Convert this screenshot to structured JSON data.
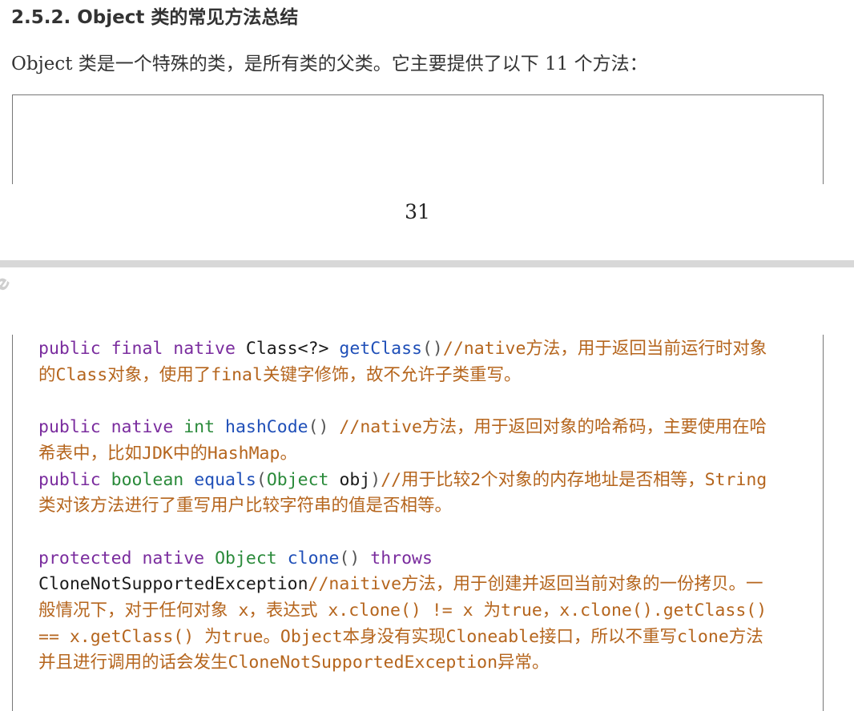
{
  "section": {
    "heading": "2.5.2. Object 类的常见方法总结",
    "intro": "Object 类是一个特殊的类，是所有类的父类。它主要提供了以下 11 个方法："
  },
  "page": {
    "number": "31",
    "watermark": "e"
  },
  "code": {
    "getClass": {
      "kw": "public final native",
      "type": "Class<?>",
      "name": "getClass",
      "paren": "()",
      "comment_a": "//native方法，用于返回当前运行时对象",
      "comment_b": "的Class对象，使用了final关键字修饰，故不允许子类重写。"
    },
    "hashCode": {
      "kw": "public native",
      "type": "int",
      "name": "hashCode",
      "paren": "()",
      "comment_a": " //native方法，用于返回对象的哈希码，主要使用在哈",
      "comment_b": "希表中，比如JDK中的HashMap。"
    },
    "equals": {
      "kw": "public",
      "type": "boolean",
      "name": "equals",
      "paren_open": "(",
      "param_type": "Object",
      "param_name": "obj",
      "paren_close": ")",
      "comment_a": "//用于比较2个对象的内存地址是否相等，String",
      "comment_b": "类对该方法进行了重写用户比较字符串的值是否相等。"
    },
    "clone": {
      "kw": "protected native",
      "type": "Object",
      "name": "clone",
      "paren": "()",
      "throws": "throws",
      "exception": "CloneNotSupportedException",
      "comment_a": "//naitive方法，用于创建并返回当前对象的一份拷贝。一",
      "comment_b": "般情况下，对于任何对象 x，表达式 x.clone() != x 为true，x.clone().getClass()",
      "comment_c": "== x.getClass() 为true。Object本身没有实现Cloneable接口，所以不重写clone方法",
      "comment_d": "并且进行调用的话会发生CloneNotSupportedException异常。"
    }
  }
}
